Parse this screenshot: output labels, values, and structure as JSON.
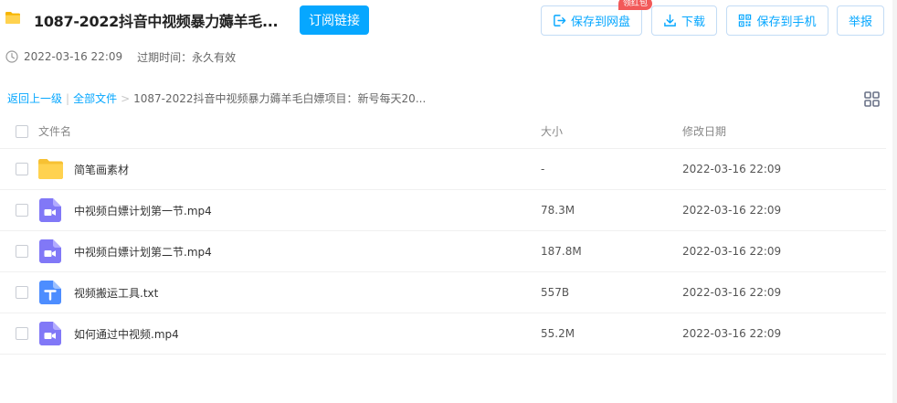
{
  "header": {
    "title": "1087-2022抖音中视频暴力薅羊毛...",
    "subscribe_label": "订阅链接",
    "save_to_netdisk": "保存到网盘",
    "download": "下载",
    "save_to_phone": "保存到手机",
    "report": "举报",
    "badge": "领红包"
  },
  "meta": {
    "date": "2022-03-16 22:09",
    "expire": "过期时间：永久有效"
  },
  "breadcrumb": {
    "back": "返回上一级",
    "sep1": "|",
    "all_files": "全部文件",
    "sep2": ">",
    "current": "1087-2022抖音中视频暴力薅羊毛白嫖项目：新号每天20..."
  },
  "table": {
    "columns": [
      "文件名",
      "大小",
      "修改日期"
    ],
    "rows": [
      {
        "icon": "folder-icon",
        "name": "简笔画素材",
        "size": "-",
        "date": "2022-03-16 22:09"
      },
      {
        "icon": "video-file-icon",
        "name": "中视频白嫖计划第一节.mp4",
        "size": "78.3M",
        "date": "2022-03-16 22:09"
      },
      {
        "icon": "video-file-icon",
        "name": "中视频白嫖计划第二节.mp4",
        "size": "187.8M",
        "date": "2022-03-16 22:09"
      },
      {
        "icon": "text-file-icon",
        "name": "视频搬运工具.txt",
        "size": "557B",
        "date": "2022-03-16 22:09"
      },
      {
        "icon": "video-file-icon",
        "name": "如何通过中视频.mp4",
        "size": "55.2M",
        "date": "2022-03-16 22:09"
      }
    ]
  },
  "colors": {
    "accent": "#06a7ff",
    "folder": "#ffd24f",
    "video": "#8178f7",
    "text_file": "#4d8dff",
    "badge": "#f25959"
  }
}
